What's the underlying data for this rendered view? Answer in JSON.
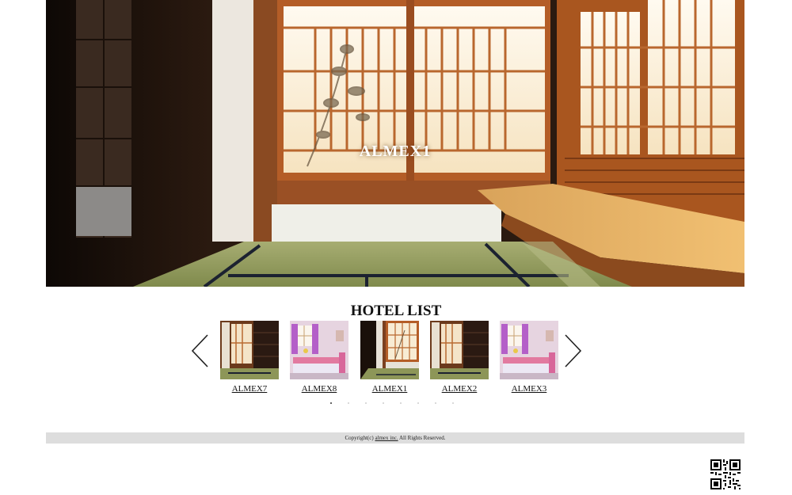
{
  "hero": {
    "title": "ALMEX1"
  },
  "hotel_list": {
    "title": "HOTEL LIST",
    "prev_icon": "chevron-left-icon",
    "next_icon": "chevron-right-icon",
    "slides": [
      {
        "label": "ALMEX7",
        "image": "tatami-room"
      },
      {
        "label": "ALMEX8",
        "image": "pink-bedroom"
      },
      {
        "label": "ALMEX1",
        "image": "shoji-room"
      },
      {
        "label": "ALMEX2",
        "image": "tatami-room"
      },
      {
        "label": "ALMEX3",
        "image": "pink-bedroom"
      }
    ],
    "pagination": {
      "total": 8,
      "active": 1
    }
  },
  "footer": {
    "prefix": "Copyright(c) ",
    "link": "almex inc.",
    "suffix": " All Rights Reserved."
  },
  "qr_icon": "qr-code-icon",
  "colors": {
    "footer_bg": "#dddddd",
    "wood": "#b5622a",
    "tatami": "#8f9a5c"
  }
}
